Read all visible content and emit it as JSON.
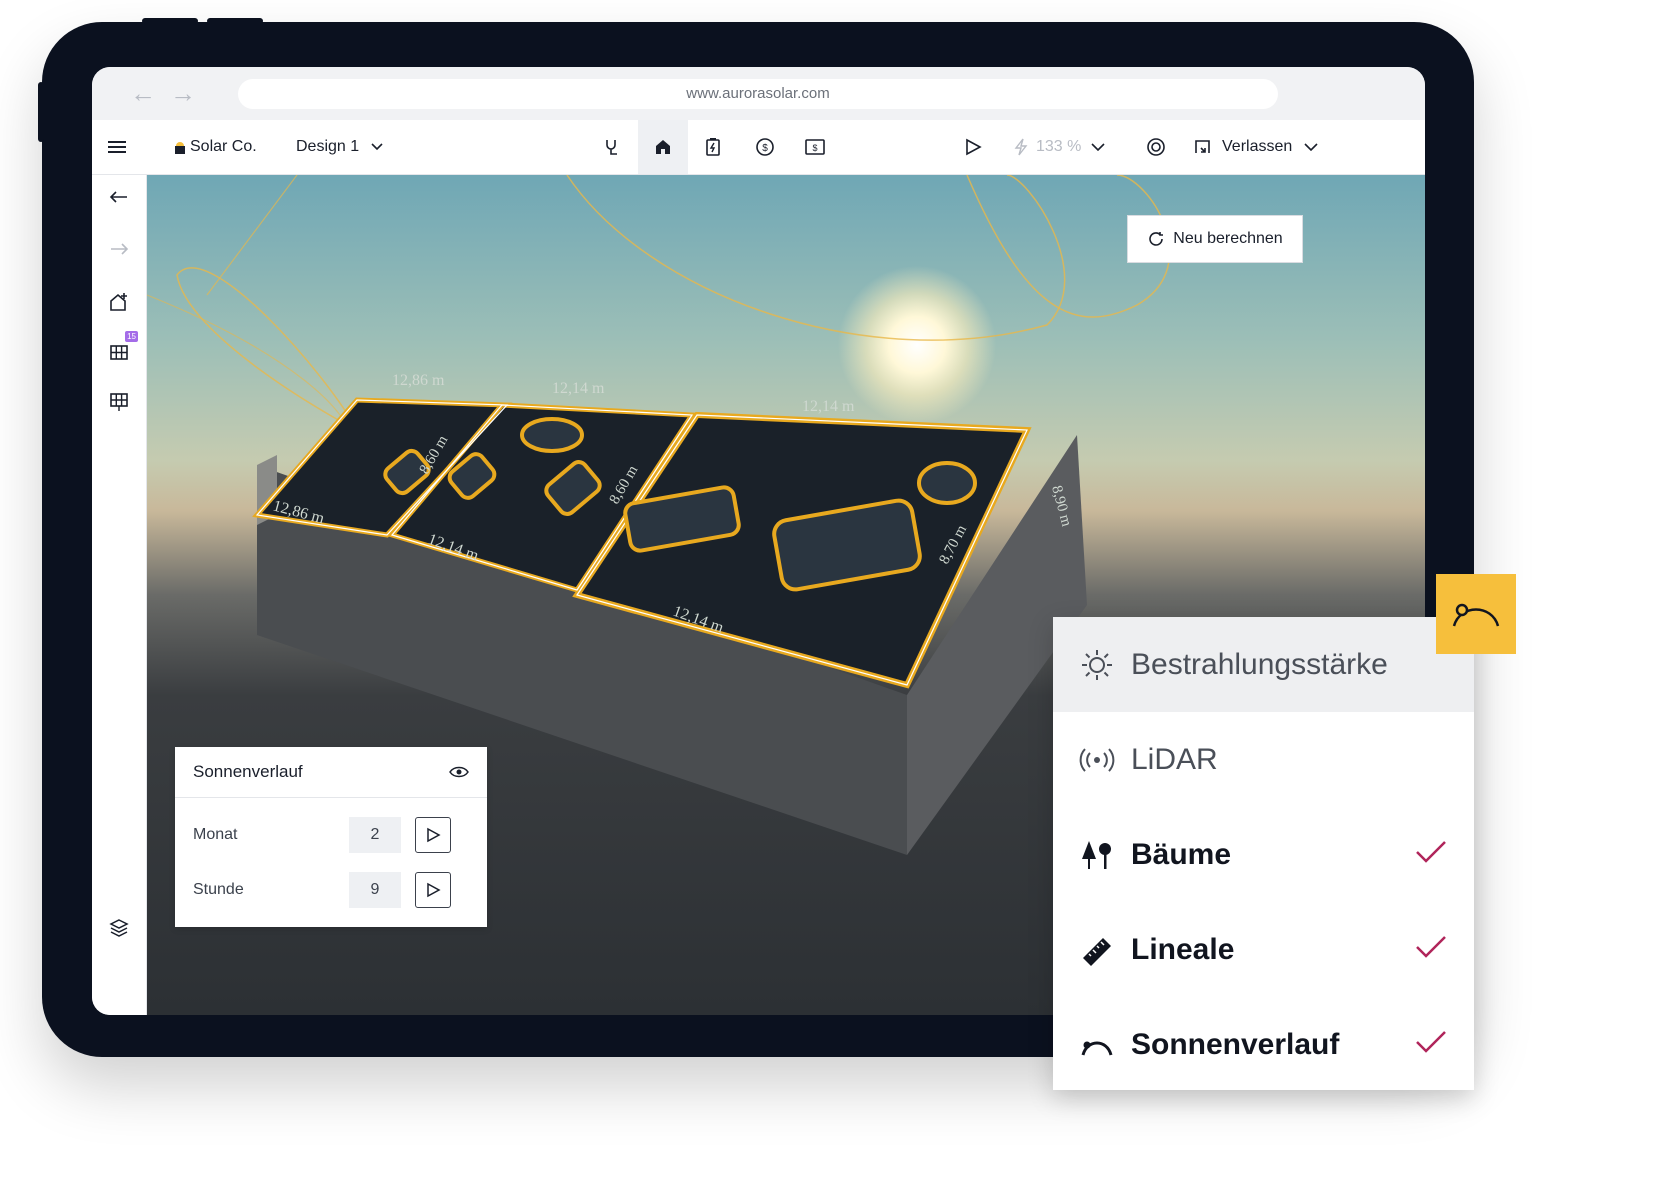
{
  "browser": {
    "url": "www.aurorasolar.com",
    "back_icon": "arrow-left-icon",
    "forward_icon": "arrow-right-icon"
  },
  "appbar": {
    "company": "Solar Co.",
    "design": "Design 1",
    "zoom": "133 %",
    "exit_label": "Verlassen"
  },
  "sidebar": {
    "badge_count": "15"
  },
  "viewport": {
    "recalc_label": "Neu berechnen",
    "measurements": [
      "12,86 m",
      "12,14 m",
      "12,14 m",
      "8,60 m",
      "8,60 m",
      "12,86 m",
      "12,14 m",
      "12,14 m",
      "8,70 m",
      "8,90 m"
    ]
  },
  "sun_panel": {
    "title": "Sonnenverlauf",
    "month_label": "Monat",
    "month_value": "2",
    "hour_label": "Stunde",
    "hour_value": "9"
  },
  "layer_menu": {
    "items": [
      {
        "label": "Bestrahlungsstärke",
        "icon": "sun-icon",
        "checked": false,
        "active": true
      },
      {
        "label": "LiDAR",
        "icon": "lidar-icon",
        "checked": false,
        "active": false
      },
      {
        "label": "Bäume",
        "icon": "trees-icon",
        "checked": true,
        "active": false
      },
      {
        "label": "Lineale",
        "icon": "ruler-icon",
        "checked": true,
        "active": false
      },
      {
        "label": "Sonnenverlauf",
        "icon": "sun-path-icon",
        "checked": true,
        "active": false
      }
    ]
  },
  "colors": {
    "accent": "#f6bf3c",
    "check": "#b0245a",
    "roof_outline": "#e8a91f"
  }
}
